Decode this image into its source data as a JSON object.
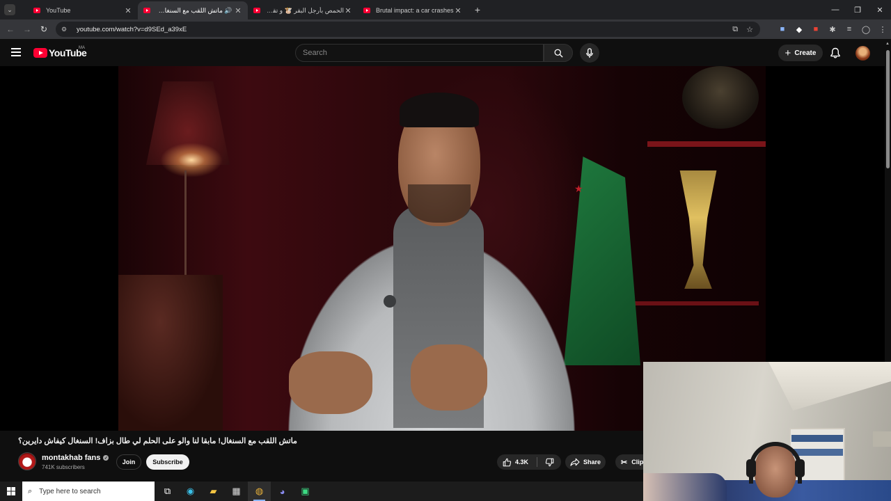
{
  "browser": {
    "tabs": [
      {
        "title": "YouTube",
        "active": false
      },
      {
        "title": "ماتش اللقب مع السنغال! ماي",
        "active": true,
        "audio": true
      },
      {
        "title": "الحمص بأرجل البقر 🐮 و تقليم أظ",
        "active": false
      },
      {
        "title": "Brutal impact: a car crashes",
        "active": false
      }
    ],
    "url": "youtube.com/watch?v=d9SEd_a39xE"
  },
  "youtube": {
    "logo_text": "YouTube",
    "country_code": "MA",
    "search_placeholder": "Search",
    "create_label": "Create"
  },
  "video": {
    "title": "ماتش اللقب مع السنغال! مابقا لنا والو على الحلم لي طال بزاف! السنغال كيفاش دايرين؟",
    "channel_name": "montakhab fans",
    "subscribers": "741K subscribers",
    "join_label": "Join",
    "subscribe_label": "Subscribe",
    "likes": "4.3K",
    "share_label": "Share",
    "clip_label": "Clip"
  },
  "taskbar": {
    "search_placeholder": "Type here to search"
  },
  "webcam": {
    "poster_text": ""
  }
}
